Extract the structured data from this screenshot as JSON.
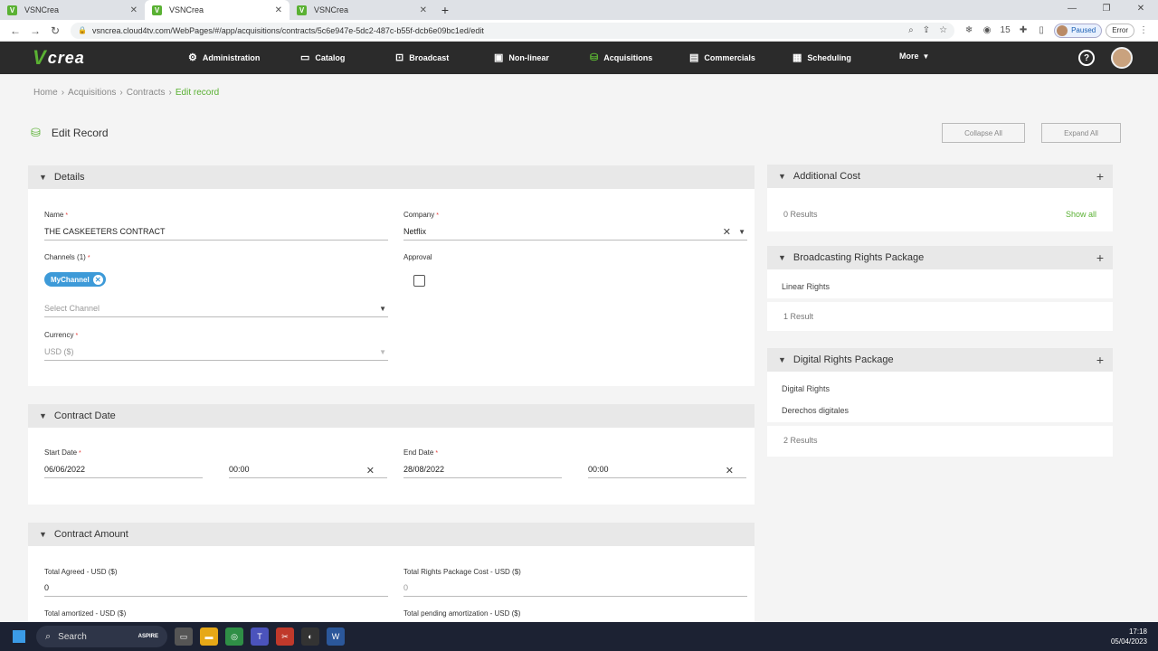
{
  "browser": {
    "tabs": [
      {
        "title": "VSNCrea",
        "active": false
      },
      {
        "title": "VSNCrea",
        "active": true
      },
      {
        "title": "VSNCrea",
        "active": false
      }
    ],
    "url": "vsncrea.cloud4tv.com/WebPages/#/app/acquisitions/contracts/5c6e947e-5dc2-487c-b55f-dcb6e09bc1ed/edit",
    "profile_status": "Paused",
    "error_label": "Error",
    "extension_badge": "15"
  },
  "app": {
    "logo_text": "crea",
    "nav": [
      {
        "label": "Administration",
        "icon": "gear-icon"
      },
      {
        "label": "Catalog",
        "icon": "monitor-icon"
      },
      {
        "label": "Broadcast",
        "icon": "cast-icon"
      },
      {
        "label": "Non-linear",
        "icon": "play-screen-icon"
      },
      {
        "label": "Acquisitions",
        "icon": "basket-icon",
        "active": true
      },
      {
        "label": "Commercials",
        "icon": "document-icon"
      },
      {
        "label": "Scheduling",
        "icon": "calendar-icon"
      },
      {
        "label": "More"
      }
    ],
    "accent": "#5ab133"
  },
  "breadcrumb": [
    "Home",
    "Acquisitions",
    "Contracts",
    "Edit record"
  ],
  "page": {
    "title": "Edit Record",
    "collapse_all": "Collapse All",
    "expand_all": "Expand All"
  },
  "details": {
    "header": "Details",
    "name_label": "Name",
    "name_value": "THE CASKEETERS CONTRACT",
    "company_label": "Company",
    "company_value": "Netflix",
    "channels_label": "Channels (1)",
    "channel_chip": "MyChannel",
    "select_channel_placeholder": "Select Channel",
    "approval_label": "Approval",
    "currency_label": "Currency",
    "currency_value": "USD ($)"
  },
  "contract_date": {
    "header": "Contract Date",
    "start_label": "Start Date",
    "start_date": "06/06/2022",
    "start_time": "00:00",
    "end_label": "End Date",
    "end_date": "28/08/2022",
    "end_time": "00:00"
  },
  "contract_amount": {
    "header": "Contract Amount",
    "total_agreed_label": "Total Agreed - USD ($)",
    "total_agreed_value": "0",
    "total_rights_label": "Total Rights Package Cost - USD ($)",
    "total_rights_value": "0",
    "total_amortized_label": "Total amortized - USD ($)",
    "total_pending_label": "Total pending amortization - USD ($)"
  },
  "additional_cost": {
    "header": "Additional Cost",
    "results": "0 Results",
    "show_all": "Show all"
  },
  "broadcasting_rights": {
    "header": "Broadcasting Rights Package",
    "items": [
      "Linear Rights"
    ],
    "results": "1 Result"
  },
  "digital_rights": {
    "header": "Digital Rights Package",
    "items": [
      "Digital Rights",
      "Derechos digitales"
    ],
    "results": "2 Results"
  },
  "taskbar": {
    "search_label": "Search",
    "badge": "ASPIRE",
    "time": "17:18",
    "date": "05/04/2023"
  }
}
